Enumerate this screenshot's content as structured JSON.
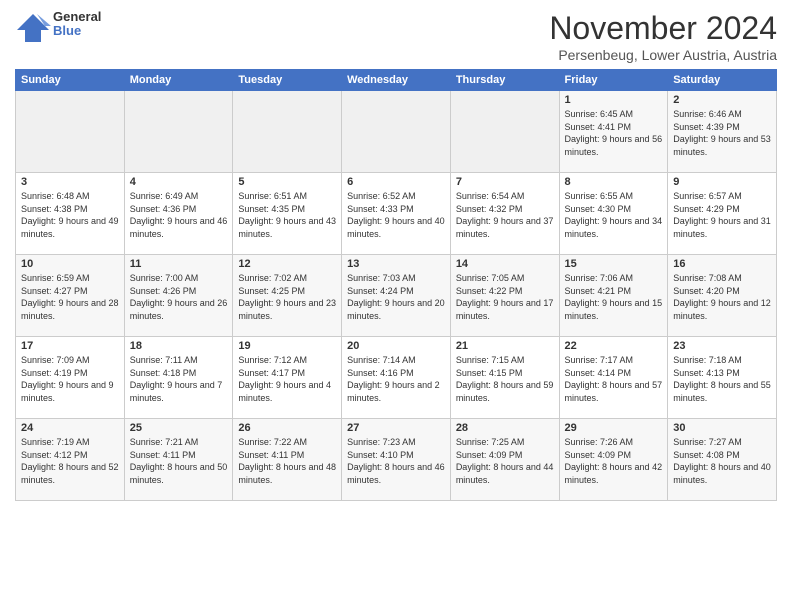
{
  "logo": {
    "line1": "General",
    "line2": "Blue"
  },
  "title": "November 2024",
  "subtitle": "Persenbeug, Lower Austria, Austria",
  "weekdays": [
    "Sunday",
    "Monday",
    "Tuesday",
    "Wednesday",
    "Thursday",
    "Friday",
    "Saturday"
  ],
  "weeks": [
    [
      {
        "day": "",
        "info": ""
      },
      {
        "day": "",
        "info": ""
      },
      {
        "day": "",
        "info": ""
      },
      {
        "day": "",
        "info": ""
      },
      {
        "day": "",
        "info": ""
      },
      {
        "day": "1",
        "info": "Sunrise: 6:45 AM\nSunset: 4:41 PM\nDaylight: 9 hours and 56 minutes."
      },
      {
        "day": "2",
        "info": "Sunrise: 6:46 AM\nSunset: 4:39 PM\nDaylight: 9 hours and 53 minutes."
      }
    ],
    [
      {
        "day": "3",
        "info": "Sunrise: 6:48 AM\nSunset: 4:38 PM\nDaylight: 9 hours and 49 minutes."
      },
      {
        "day": "4",
        "info": "Sunrise: 6:49 AM\nSunset: 4:36 PM\nDaylight: 9 hours and 46 minutes."
      },
      {
        "day": "5",
        "info": "Sunrise: 6:51 AM\nSunset: 4:35 PM\nDaylight: 9 hours and 43 minutes."
      },
      {
        "day": "6",
        "info": "Sunrise: 6:52 AM\nSunset: 4:33 PM\nDaylight: 9 hours and 40 minutes."
      },
      {
        "day": "7",
        "info": "Sunrise: 6:54 AM\nSunset: 4:32 PM\nDaylight: 9 hours and 37 minutes."
      },
      {
        "day": "8",
        "info": "Sunrise: 6:55 AM\nSunset: 4:30 PM\nDaylight: 9 hours and 34 minutes."
      },
      {
        "day": "9",
        "info": "Sunrise: 6:57 AM\nSunset: 4:29 PM\nDaylight: 9 hours and 31 minutes."
      }
    ],
    [
      {
        "day": "10",
        "info": "Sunrise: 6:59 AM\nSunset: 4:27 PM\nDaylight: 9 hours and 28 minutes."
      },
      {
        "day": "11",
        "info": "Sunrise: 7:00 AM\nSunset: 4:26 PM\nDaylight: 9 hours and 26 minutes."
      },
      {
        "day": "12",
        "info": "Sunrise: 7:02 AM\nSunset: 4:25 PM\nDaylight: 9 hours and 23 minutes."
      },
      {
        "day": "13",
        "info": "Sunrise: 7:03 AM\nSunset: 4:24 PM\nDaylight: 9 hours and 20 minutes."
      },
      {
        "day": "14",
        "info": "Sunrise: 7:05 AM\nSunset: 4:22 PM\nDaylight: 9 hours and 17 minutes."
      },
      {
        "day": "15",
        "info": "Sunrise: 7:06 AM\nSunset: 4:21 PM\nDaylight: 9 hours and 15 minutes."
      },
      {
        "day": "16",
        "info": "Sunrise: 7:08 AM\nSunset: 4:20 PM\nDaylight: 9 hours and 12 minutes."
      }
    ],
    [
      {
        "day": "17",
        "info": "Sunrise: 7:09 AM\nSunset: 4:19 PM\nDaylight: 9 hours and 9 minutes."
      },
      {
        "day": "18",
        "info": "Sunrise: 7:11 AM\nSunset: 4:18 PM\nDaylight: 9 hours and 7 minutes."
      },
      {
        "day": "19",
        "info": "Sunrise: 7:12 AM\nSunset: 4:17 PM\nDaylight: 9 hours and 4 minutes."
      },
      {
        "day": "20",
        "info": "Sunrise: 7:14 AM\nSunset: 4:16 PM\nDaylight: 9 hours and 2 minutes."
      },
      {
        "day": "21",
        "info": "Sunrise: 7:15 AM\nSunset: 4:15 PM\nDaylight: 8 hours and 59 minutes."
      },
      {
        "day": "22",
        "info": "Sunrise: 7:17 AM\nSunset: 4:14 PM\nDaylight: 8 hours and 57 minutes."
      },
      {
        "day": "23",
        "info": "Sunrise: 7:18 AM\nSunset: 4:13 PM\nDaylight: 8 hours and 55 minutes."
      }
    ],
    [
      {
        "day": "24",
        "info": "Sunrise: 7:19 AM\nSunset: 4:12 PM\nDaylight: 8 hours and 52 minutes."
      },
      {
        "day": "25",
        "info": "Sunrise: 7:21 AM\nSunset: 4:11 PM\nDaylight: 8 hours and 50 minutes."
      },
      {
        "day": "26",
        "info": "Sunrise: 7:22 AM\nSunset: 4:11 PM\nDaylight: 8 hours and 48 minutes."
      },
      {
        "day": "27",
        "info": "Sunrise: 7:23 AM\nSunset: 4:10 PM\nDaylight: 8 hours and 46 minutes."
      },
      {
        "day": "28",
        "info": "Sunrise: 7:25 AM\nSunset: 4:09 PM\nDaylight: 8 hours and 44 minutes."
      },
      {
        "day": "29",
        "info": "Sunrise: 7:26 AM\nSunset: 4:09 PM\nDaylight: 8 hours and 42 minutes."
      },
      {
        "day": "30",
        "info": "Sunrise: 7:27 AM\nSunset: 4:08 PM\nDaylight: 8 hours and 40 minutes."
      }
    ]
  ],
  "colors": {
    "header_bg": "#4472c4",
    "header_text": "#ffffff",
    "odd_row": "#f7f7f7",
    "even_row": "#ffffff"
  }
}
